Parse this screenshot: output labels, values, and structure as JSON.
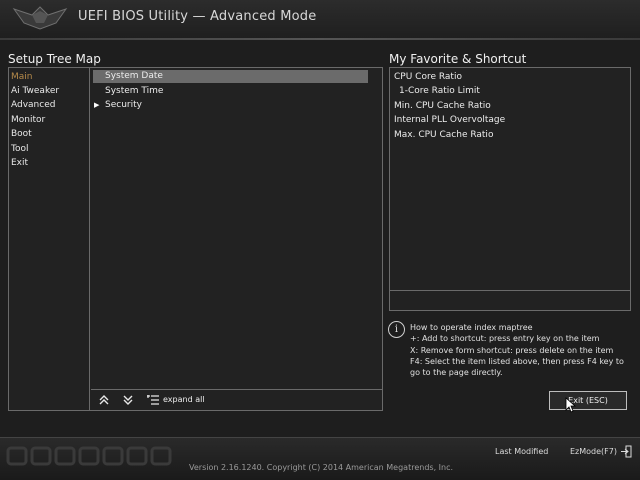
{
  "header": {
    "title": "UEFI BIOS Utility — Advanced Mode"
  },
  "setup_tree": {
    "title": "Setup Tree Map",
    "menu": [
      {
        "label": "Main",
        "active": true
      },
      {
        "label": "Ai Tweaker"
      },
      {
        "label": "Advanced"
      },
      {
        "label": "Monitor"
      },
      {
        "label": "Boot"
      },
      {
        "label": "Tool"
      },
      {
        "label": "Exit"
      }
    ],
    "items": [
      {
        "label": "System Date",
        "selected": true
      },
      {
        "label": "System Time"
      },
      {
        "label": "Security",
        "expandable": true
      }
    ],
    "expand_all_label": "expand all"
  },
  "favorites": {
    "title": "My Favorite & Shortcut",
    "items": [
      "CPU Core Ratio",
      "1-Core Ratio Limit",
      "Min. CPU Cache Ratio",
      "Internal PLL Overvoltage",
      "Max. CPU Cache Ratio"
    ]
  },
  "help": {
    "lines": [
      "How to operate index maptree",
      "+: Add to shortcut: press entry key on the item",
      "X: Remove form shortcut: press delete on the item",
      "F4: Select the item listed above, then press F4 key to",
      "go to the page directly."
    ]
  },
  "exit_button": "Exit (ESC)",
  "footer": {
    "last_modified": "Last Modified",
    "ezmode": "EzMode(F7)",
    "version": "Version 2.16.1240. Copyright (C) 2014 American Megatrends, Inc."
  },
  "colors": {
    "active_menu": "#b58a4a",
    "selected_row": "#6b6b6b",
    "border": "#6a6a6a"
  },
  "icons": [
    "logo-icon",
    "arrow-right-icon",
    "collapse-up-icon",
    "expand-down-icon",
    "expand-all-icon",
    "info-icon",
    "mouse-cursor-icon",
    "ezmode-icon"
  ]
}
